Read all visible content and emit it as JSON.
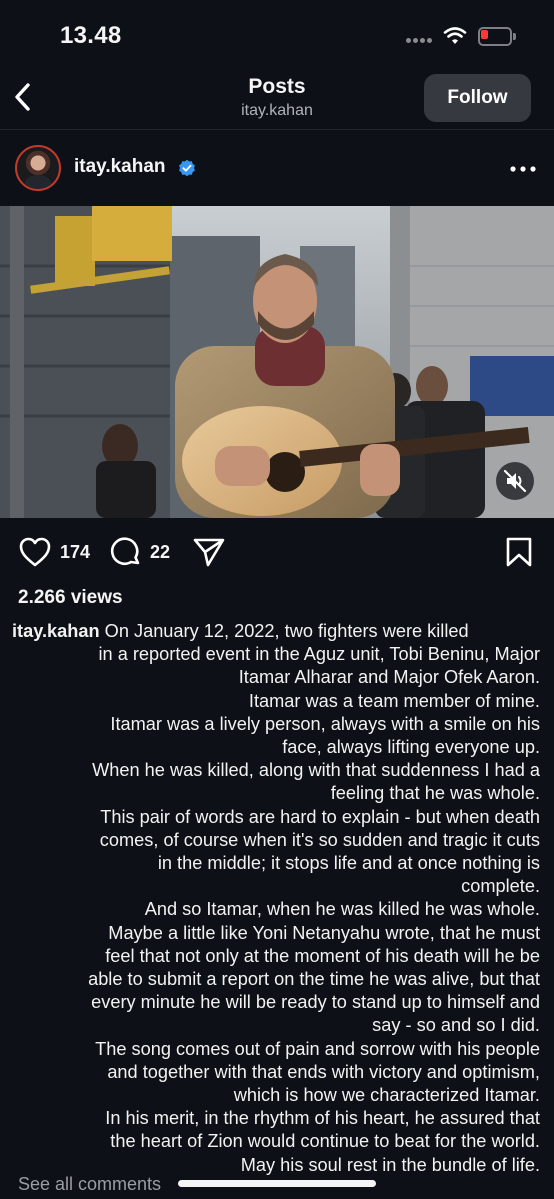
{
  "status_bar": {
    "time": "13.48"
  },
  "header": {
    "title": "Posts",
    "subtitle": "itay.kahan",
    "follow_label": "Follow"
  },
  "post": {
    "author": "itay.kahan",
    "likes": "174",
    "comments": "22",
    "views": "2.266 views",
    "caption_lines": [
      "On January 12, 2022, two fighters were killed",
      "in a reported event in the Aguz unit, Tobi Beninu, Major",
      "Itamar Alharar and Major Ofek Aaron.",
      "Itamar was a team member of mine.",
      "Itamar was a lively person, always with a smile on his",
      "face, always lifting everyone up.",
      "When he was killed, along with that suddenness I had a",
      "feeling that he was whole.",
      "This pair of words are hard to explain - but when death",
      "comes, of course when it's so sudden and tragic it cuts",
      "in the middle; it stops life and at once nothing is",
      "complete.",
      "And so Itamar, when he was killed he was whole.",
      "Maybe a little like Yoni Netanyahu wrote, that he must",
      "feel that not only at the moment of his death will he be",
      "able to submit a report on the time he was alive, but that",
      "every minute he will be ready to stand up to himself and",
      "say - so and so I did.",
      "The song comes out of pain and sorrow with his people",
      "and together with that ends with victory and optimism,",
      "which is how we characterized Itamar.",
      "In his merit, in the rhythm of his heart, he assured that",
      "the heart of Zion would continue to beat for the world.",
      "May his soul rest in the bundle of life."
    ],
    "see_all_comments": "See all comments"
  },
  "colors": {
    "background": "#0d1016",
    "follow_button": "#363940",
    "verified": "#3897f0",
    "battery_low": "#ff3b30"
  },
  "icons": [
    "back-icon",
    "verified-icon",
    "more-icon",
    "heart-icon",
    "comment-icon",
    "share-icon",
    "bookmark-icon",
    "mute-icon",
    "wifi-icon",
    "battery-icon"
  ]
}
